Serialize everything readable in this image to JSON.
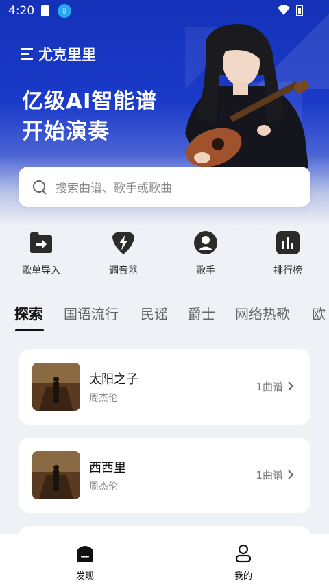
{
  "status_bar": {
    "time": "4:20"
  },
  "header": {
    "app_name": "尤克里里",
    "hero_title_line1": "亿级AI智能谱",
    "hero_title_line2": "开始演奏"
  },
  "search": {
    "placeholder": "搜索曲谱、歌手或歌曲"
  },
  "quick_actions": [
    {
      "label": "歌单导入",
      "icon": "folder-import-icon"
    },
    {
      "label": "调音器",
      "icon": "tuner-pick-icon"
    },
    {
      "label": "歌手",
      "icon": "singer-avatar-icon"
    },
    {
      "label": "排行榜",
      "icon": "ranking-chart-icon"
    }
  ],
  "tabs": [
    {
      "label": "探索",
      "active": true
    },
    {
      "label": "国语流行"
    },
    {
      "label": "民谣"
    },
    {
      "label": "爵士"
    },
    {
      "label": "网络热歌"
    },
    {
      "label": "欧"
    }
  ],
  "songs": [
    {
      "title": "太阳之子",
      "artist": "周杰伦",
      "count": "1曲谱"
    },
    {
      "title": "西西里",
      "artist": "周杰伦",
      "count": "1曲谱"
    }
  ],
  "bottom_nav": [
    {
      "label": "发现",
      "icon": "discover-home-icon",
      "active": true
    },
    {
      "label": "我的",
      "icon": "profile-icon"
    }
  ],
  "colors": {
    "hero_blue": "#1a3ac9",
    "accent_dark": "#111111",
    "download_badge": "#29a8f2"
  }
}
